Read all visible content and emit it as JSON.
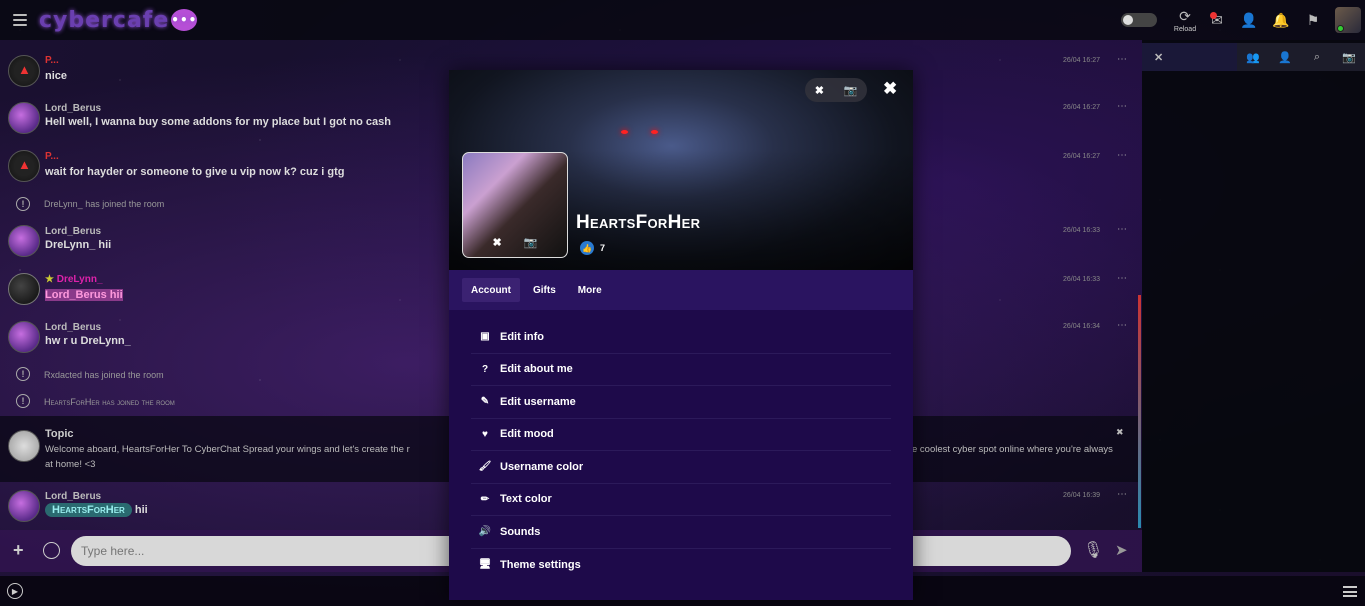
{
  "app": {
    "logo_text": "cybercafe",
    "logo_bubble_icon": "chat-bubble-icon"
  },
  "topbar": {
    "reload_label": "Reload"
  },
  "messages": [
    {
      "user": "P...",
      "text": "nice",
      "time": "26/04 16:27",
      "avatar": "a-logo"
    },
    {
      "user": "Lord_Berus",
      "text": "Hell well, I wanna buy some addons for my place but I got no cash",
      "time": "26/04 16:27",
      "avatar": "lord"
    },
    {
      "user": "P...",
      "text": "wait for hayder or someone to give u vip now k? cuz i gtg",
      "time": "26/04 16:27",
      "avatar": "a-logo"
    },
    {
      "user": "Lord_Berus",
      "text": "DreLynn_ hii",
      "time": "26/04 16:33",
      "avatar": "lord"
    },
    {
      "user": "DreLynn_",
      "text": "Lord_Berus hii",
      "time": "26/04 16:33",
      "avatar": "dre"
    },
    {
      "user": "Lord_Berus",
      "text": "hw r u DreLynn_",
      "time": "26/04 16:34",
      "avatar": "lord"
    },
    {
      "user": "Lord_Berus",
      "text": "hii",
      "time": "26/04 16:39",
      "avatar": "lord",
      "mention": "HeartsForHer"
    }
  ],
  "system": [
    {
      "text": "DreLynn_ has joined the room"
    },
    {
      "text": "Rxdacted has joined the room"
    },
    {
      "text": "HeartsForHer has joined the room"
    }
  ],
  "topic": {
    "title": "Topic",
    "text": "Welcome aboard, HeartsForHer To CyberChat Spread your wings and let's create the r",
    "text2": "e coolest cyber spot online where you're always",
    "text3": "at home! <3"
  },
  "input": {
    "placeholder": "Type here..."
  },
  "modal": {
    "username": "HeartsForHer",
    "likes": "7",
    "tabs": [
      {
        "label": "Account"
      },
      {
        "label": "Gifts"
      },
      {
        "label": "More"
      }
    ],
    "menu": [
      {
        "label": "Edit info",
        "icon": "id-card-icon"
      },
      {
        "label": "Edit about me",
        "icon": "question-circle-icon"
      },
      {
        "label": "Edit username",
        "icon": "edit-icon"
      },
      {
        "label": "Edit mood",
        "icon": "heart-icon"
      },
      {
        "label": "Username color",
        "icon": "brush-icon"
      },
      {
        "label": "Text color",
        "icon": "pencil-icon"
      },
      {
        "label": "Sounds",
        "icon": "volume-icon"
      },
      {
        "label": "Theme settings",
        "icon": "monitor-icon"
      }
    ]
  },
  "colors": {
    "accent": "#1e0a4a",
    "tab_bar": "#2a1460",
    "logo": "#6a3fb0",
    "mention_bg": "#2a6a70"
  }
}
